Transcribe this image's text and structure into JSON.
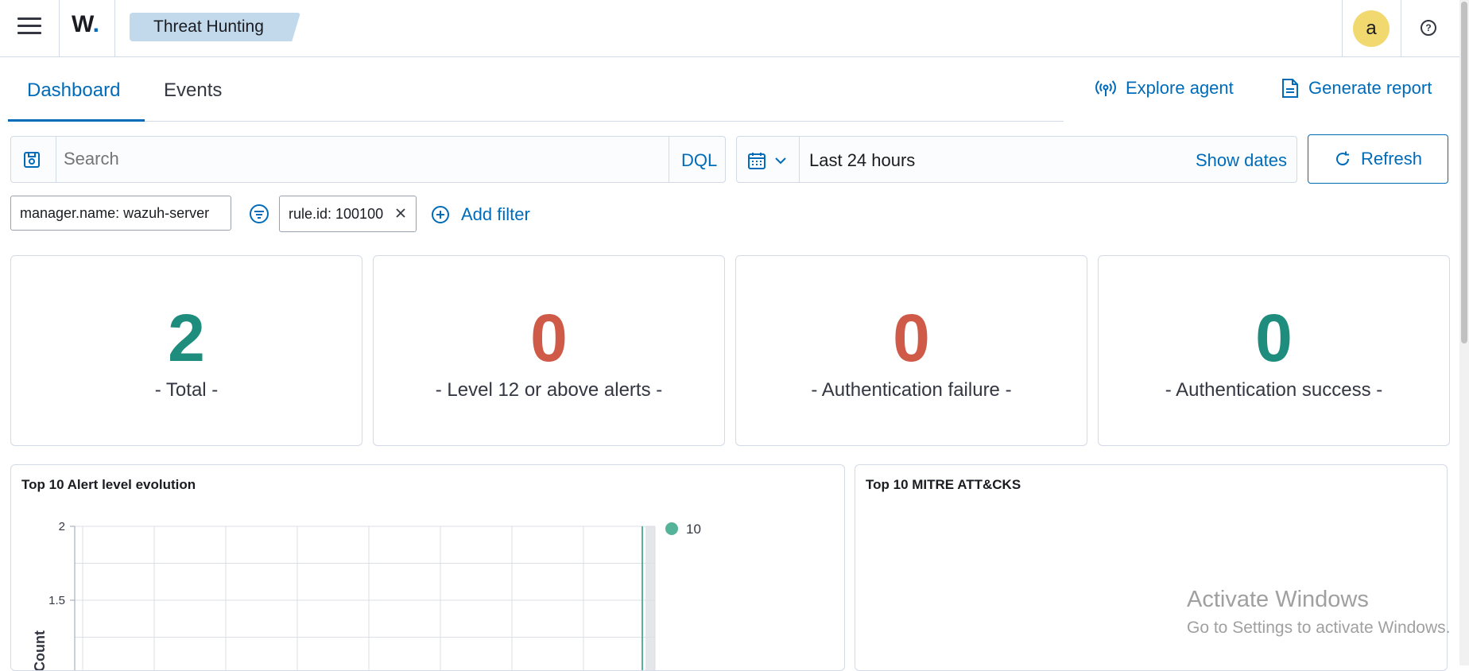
{
  "header": {
    "logo_text": "W",
    "logo_dot": ".",
    "breadcrumb": "Threat Hunting",
    "avatar_initial": "a",
    "help_glyph": "?"
  },
  "tabs": [
    {
      "label": "Dashboard",
      "active": true
    },
    {
      "label": "Events",
      "active": false
    }
  ],
  "actions": {
    "explore_agent": "Explore agent",
    "generate_report": "Generate report"
  },
  "search": {
    "placeholder": "Search",
    "language": "DQL"
  },
  "time": {
    "range": "Last 24 hours",
    "show_dates": "Show dates",
    "refresh": "Refresh"
  },
  "filters": {
    "pinned": "manager.name: wazuh-server",
    "rule": "rule.id: 100100",
    "add_filter": "Add filter"
  },
  "stats": [
    {
      "value": "2",
      "label": "- Total -",
      "color": "#1f8d7e"
    },
    {
      "value": "0",
      "label": "- Level 12 or above alerts -",
      "color": "#cf5a47"
    },
    {
      "value": "0",
      "label": "- Authentication failure -",
      "color": "#cf5a47"
    },
    {
      "value": "0",
      "label": "- Authentication success -",
      "color": "#1f8d7e"
    }
  ],
  "panels": {
    "alert_evolution": "Top 10 Alert level evolution",
    "mitre": "Top 10 MITRE ATT&CKS"
  },
  "chart_data": {
    "type": "line",
    "title": "Top 10 Alert level evolution",
    "ylabel": "Count",
    "yticks": [
      "2",
      "1.5"
    ],
    "ylim": [
      0,
      2
    ],
    "grid": true,
    "legend": {
      "placement": "right",
      "entries": [
        {
          "name": "10",
          "color": "#54b399"
        }
      ]
    },
    "series": [
      {
        "name": "10",
        "color": "#54b399"
      }
    ]
  },
  "watermark": {
    "title": "Activate Windows",
    "subtitle": "Go to Settings to activate Windows."
  }
}
